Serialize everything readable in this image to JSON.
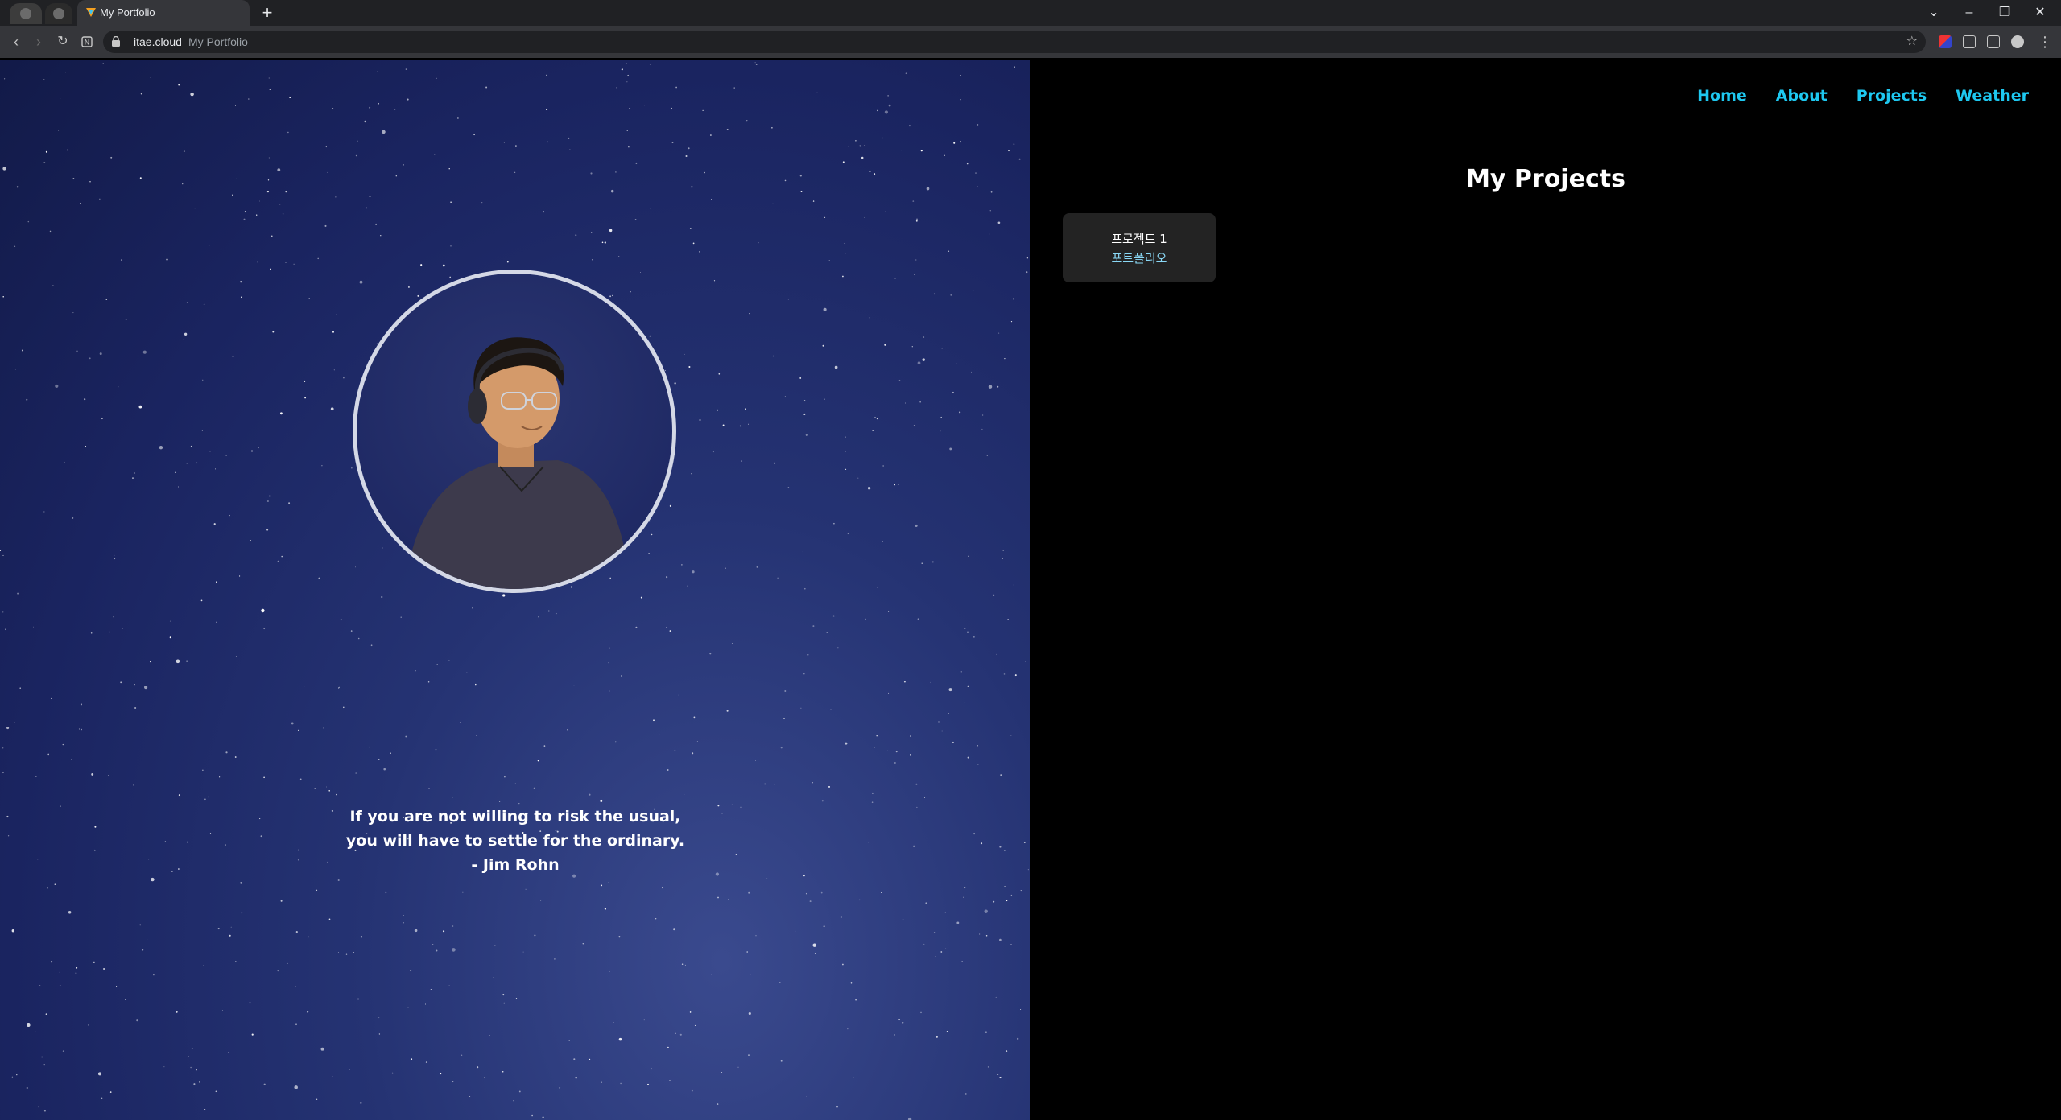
{
  "browser": {
    "tab_title": "My Portfolio",
    "url_host": "itae.cloud",
    "url_page_title": "My Portfolio",
    "new_tab_symbol": "+",
    "window_controls": {
      "minimize": "–",
      "restore": "❐",
      "close": "✕",
      "tab_search": "⌄"
    }
  },
  "hero": {
    "quote_lines": [
      "If you are not willing to risk the usual,",
      "you will have to settle for the ordinary.",
      "- Jim Rohn"
    ]
  },
  "nav": {
    "items": [
      "Home",
      "About",
      "Projects",
      "Weather"
    ]
  },
  "projects": {
    "title": "My Projects",
    "cards": [
      {
        "name": "프로젝트 1",
        "link": "포트폴리오"
      }
    ]
  },
  "colors": {
    "nav_link": "#1ec8f0",
    "card_bg": "#232323",
    "card_link": "#8ad8f6",
    "hero_bg": "#1a2460"
  }
}
